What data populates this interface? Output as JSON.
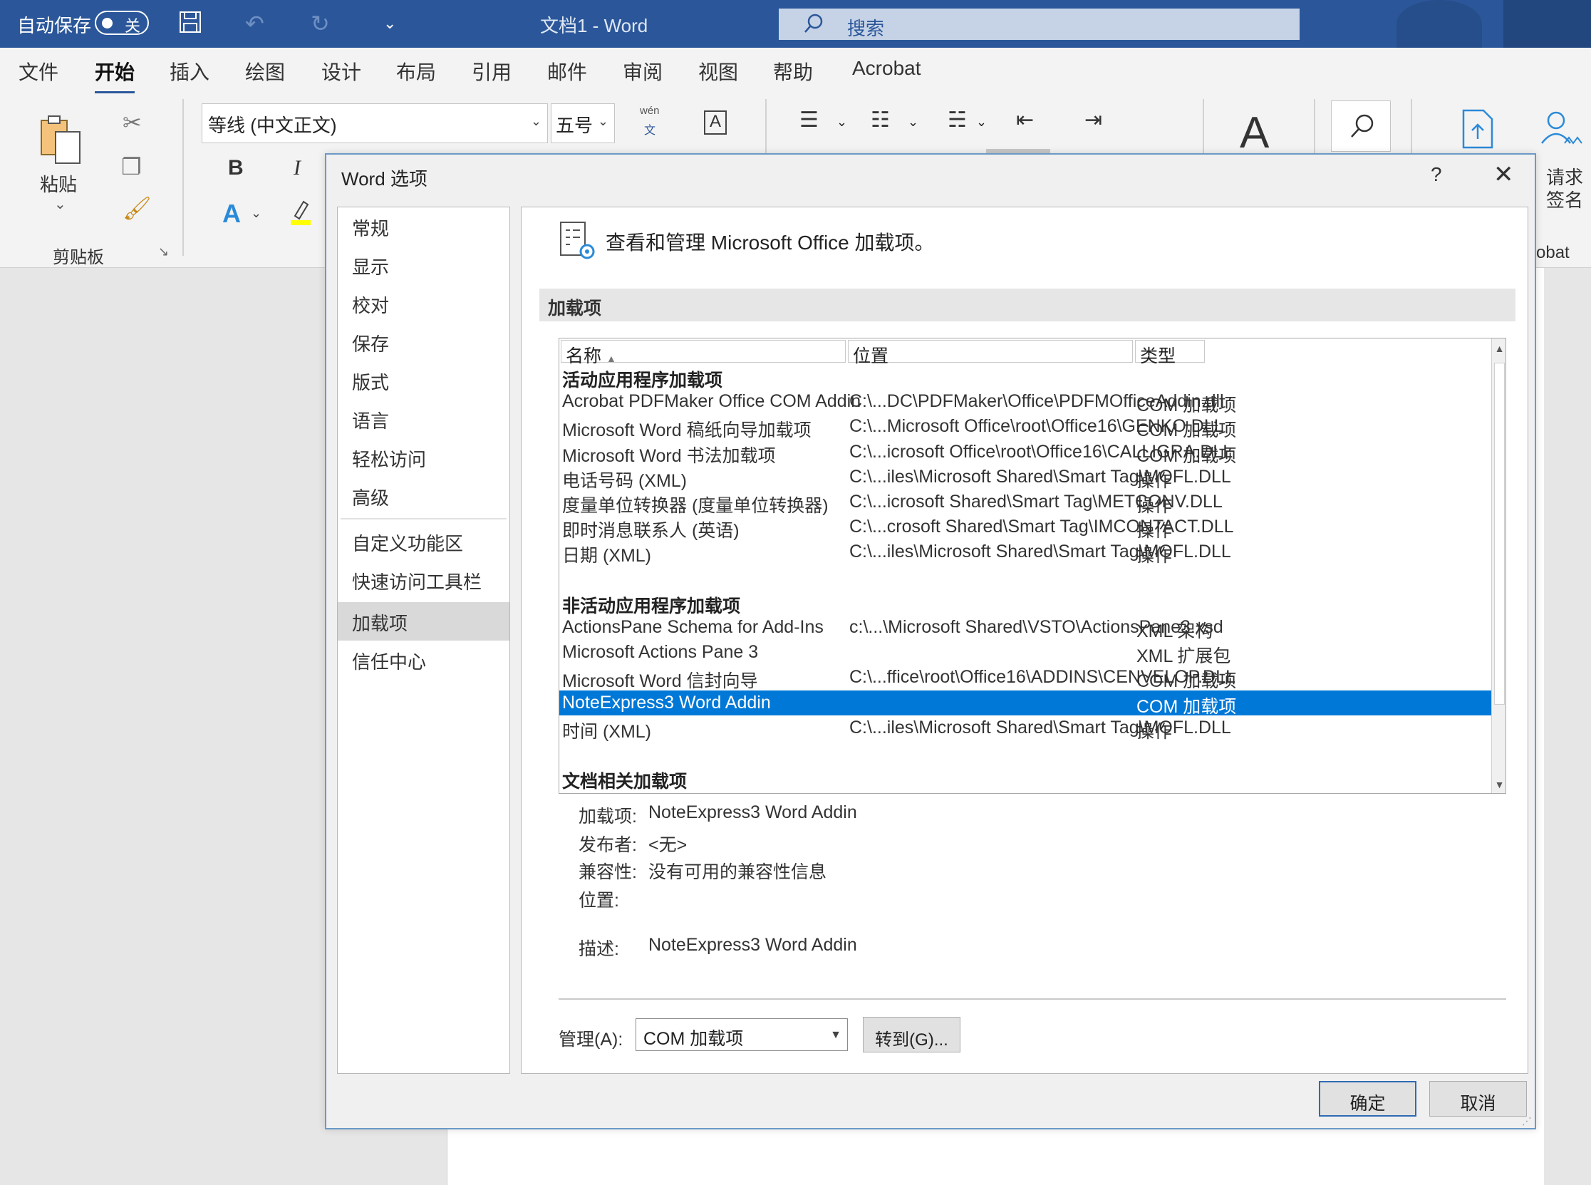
{
  "titlebar": {
    "autosave_label": "自动保存",
    "autosave_state": "关",
    "doc_title": "文档1  -  Word",
    "search_placeholder": "搜索",
    "search_icon": "search-icon"
  },
  "menu": [
    "文件",
    "开始",
    "插入",
    "绘图",
    "设计",
    "布局",
    "引用",
    "邮件",
    "审阅",
    "视图",
    "帮助",
    "Acrobat"
  ],
  "menu_active_index": 1,
  "ribbon": {
    "paste_label": "粘贴",
    "clipboard_group": "剪贴板",
    "font_name": "等线 (中文正文)",
    "font_size": "五号",
    "bold": "B",
    "italic": "I",
    "phonetic_top": "wén",
    "phonetic_bottom": "文",
    "charbox": "A",
    "sign_label_1": "请求",
    "sign_label_2": "签名",
    "acrobat_group_fragment": "obat"
  },
  "dialog": {
    "title": "Word 选项",
    "help": "?",
    "close": "✕",
    "nav": {
      "items_top": [
        "常规",
        "显示",
        "校对",
        "保存",
        "版式",
        "语言",
        "轻松访问",
        "高级"
      ],
      "items_mid": [
        "自定义功能区",
        "快速访问工具栏"
      ],
      "items_bottom": [
        "加载项",
        "信任中心"
      ],
      "selected": "加载项"
    },
    "header_text": "查看和管理 Microsoft Office 加载项。",
    "section_title": "加载项",
    "columns": {
      "name": "名称",
      "location": "位置",
      "type": "类型"
    },
    "groups": [
      {
        "title": "活动应用程序加载项",
        "rows": [
          {
            "name": "Acrobat PDFMaker Office COM Addin",
            "location": "C:\\...DC\\PDFMaker\\Office\\PDFMOfficeAddin.dll",
            "type": "COM 加载项"
          },
          {
            "name": "Microsoft Word 稿纸向导加载项",
            "location": "C:\\...Microsoft Office\\root\\Office16\\GENKO.DLL",
            "type": "COM 加载项"
          },
          {
            "name": "Microsoft Word 书法加载项",
            "location": "C:\\...icrosoft Office\\root\\Office16\\CALLIGRA.DLL",
            "type": "COM 加载项"
          },
          {
            "name": "电话号码 (XML)",
            "location": "C:\\...iles\\Microsoft Shared\\Smart Tag\\MOFL.DLL",
            "type": "操作"
          },
          {
            "name": "度量单位转换器 (度量单位转换器)",
            "location": "C:\\...icrosoft Shared\\Smart Tag\\METCONV.DLL",
            "type": "操作"
          },
          {
            "name": "即时消息联系人 (英语)",
            "location": "C:\\...crosoft Shared\\Smart Tag\\IMCONTACT.DLL",
            "type": "操作"
          },
          {
            "name": "日期 (XML)",
            "location": "C:\\...iles\\Microsoft Shared\\Smart Tag\\MOFL.DLL",
            "type": "操作"
          }
        ]
      },
      {
        "title": "非活动应用程序加载项",
        "rows": [
          {
            "name": "ActionsPane Schema for Add-Ins",
            "location": "c:\\...\\Microsoft Shared\\VSTO\\ActionsPane3.xsd",
            "type": "XML 架构"
          },
          {
            "name": "Microsoft Actions Pane 3",
            "location": "",
            "type": "XML 扩展包"
          },
          {
            "name": "Microsoft Word 信封向导",
            "location": "C:\\...ffice\\root\\Office16\\ADDINS\\CENVELOP.DLL",
            "type": "COM 加载项"
          },
          {
            "name": "NoteExpress3 Word Addin",
            "location": "",
            "type": "COM 加载项",
            "selected": true
          },
          {
            "name": "时间 (XML)",
            "location": "C:\\...iles\\Microsoft Shared\\Smart Tag\\MOFL.DLL",
            "type": "操作"
          }
        ]
      },
      {
        "title": "文档相关加载项",
        "rows": []
      }
    ],
    "details": {
      "addin_label": "加载项:",
      "addin_value": "NoteExpress3 Word Addin",
      "publisher_label": "发布者:",
      "publisher_value": "<无>",
      "compat_label": "兼容性:",
      "compat_value": "没有可用的兼容性信息",
      "location_label": "位置:",
      "location_value": "",
      "desc_label": "描述:",
      "desc_value": "NoteExpress3 Word Addin"
    },
    "manage_label": "管理(A):",
    "manage_value": "COM 加载项",
    "goto_label": "转到(G)...",
    "ok_label": "确定",
    "cancel_label": "取消"
  }
}
